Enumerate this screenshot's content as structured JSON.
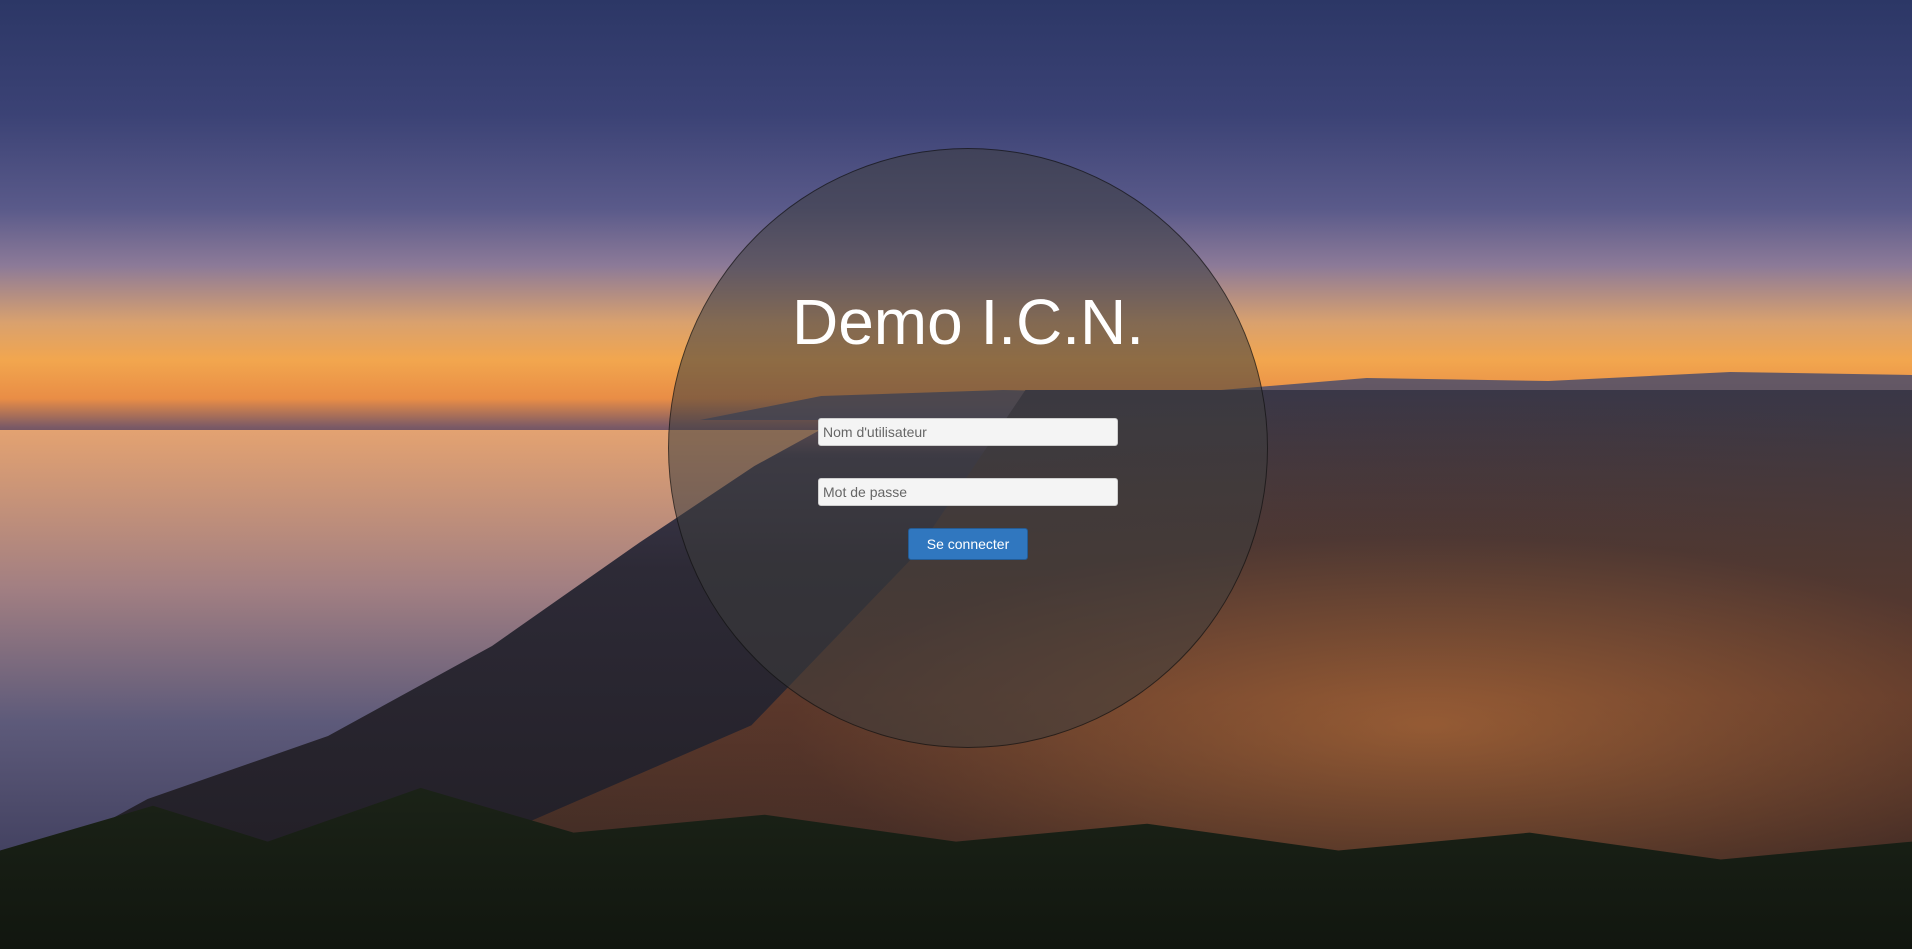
{
  "page": {
    "title": "Demo I.C.N."
  },
  "form": {
    "username_placeholder": "Nom d'utilisateur",
    "password_placeholder": "Mot de passe",
    "submit_label": "Se connecter"
  },
  "colors": {
    "button": "#3077bf",
    "title_text": "#ffffff",
    "circle_overlay": "rgba(60,60,60,0.55)"
  }
}
